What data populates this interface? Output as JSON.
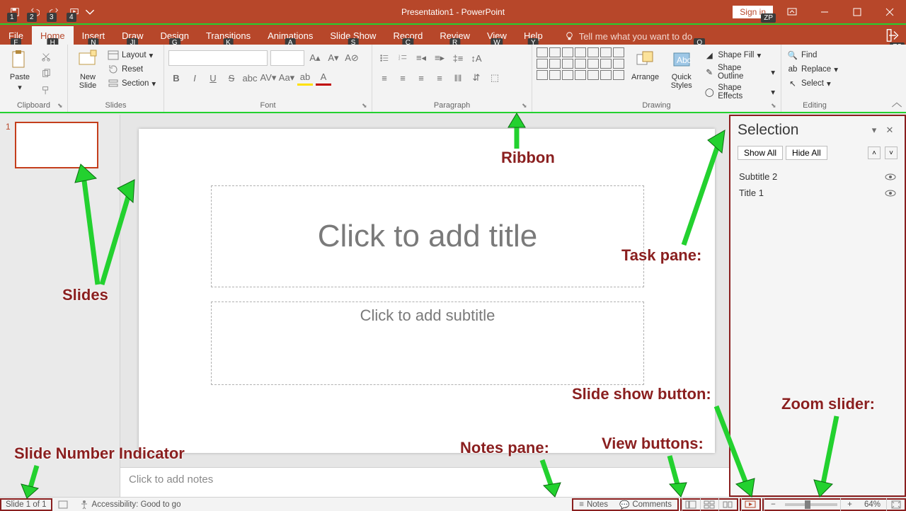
{
  "window": {
    "title": "Presentation1 - PowerPoint"
  },
  "account": {
    "signin": "Sign in"
  },
  "qat_keytips": [
    "1",
    "2",
    "3",
    "4"
  ],
  "tabs": [
    {
      "label": "File",
      "key": "F"
    },
    {
      "label": "Home",
      "key": "H",
      "active": true
    },
    {
      "label": "Insert",
      "key": "N"
    },
    {
      "label": "Draw",
      "key": "JI"
    },
    {
      "label": "Design",
      "key": "G"
    },
    {
      "label": "Transitions",
      "key": "K"
    },
    {
      "label": "Animations",
      "key": "A"
    },
    {
      "label": "Slide Show",
      "key": "S"
    },
    {
      "label": "Record",
      "key": "C"
    },
    {
      "label": "Review",
      "key": "R"
    },
    {
      "label": "View",
      "key": "W"
    },
    {
      "label": "Help",
      "key": "Y"
    }
  ],
  "tellme": {
    "text": "Tell me what you want to do",
    "key": "Q"
  },
  "share_key": "ZS",
  "ribbon": {
    "clipboard": {
      "label": "Clipboard",
      "paste": "Paste"
    },
    "slides": {
      "label": "Slides",
      "new_slide": "New\nSlide",
      "layout": "Layout",
      "reset": "Reset",
      "section": "Section"
    },
    "font": {
      "label": "Font"
    },
    "paragraph": {
      "label": "Paragraph"
    },
    "drawing": {
      "label": "Drawing",
      "arrange": "Arrange",
      "quick": "Quick\nStyles",
      "fill": "Shape Fill",
      "outline": "Shape Outline",
      "effects": "Shape Effects"
    },
    "editing": {
      "label": "Editing",
      "find": "Find",
      "replace": "Replace",
      "select": "Select"
    }
  },
  "thumbnails": {
    "first_num": "1"
  },
  "slide": {
    "title_ph": "Click to add title",
    "subtitle_ph": "Click to add subtitle"
  },
  "notes_ph": "Click to add notes",
  "taskpane": {
    "title": "Selection",
    "show_all": "Show All",
    "hide_all": "Hide All",
    "items": [
      "Subtitle 2",
      "Title 1"
    ]
  },
  "statusbar": {
    "slide_indicator": "Slide 1 of 1",
    "accessibility": "Accessibility: Good to go",
    "notes": "Notes",
    "comments": "Comments",
    "zoom": "64%"
  },
  "annotations": {
    "ribbon": "Ribbon",
    "task_pane": "Task pane:",
    "slides": "Slides",
    "slide_number": "Slide Number Indicator",
    "notes_pane": "Notes pane:",
    "view_buttons": "View buttons:",
    "slide_show": "Slide show button:",
    "zoom_slider": "Zoom slider:"
  }
}
